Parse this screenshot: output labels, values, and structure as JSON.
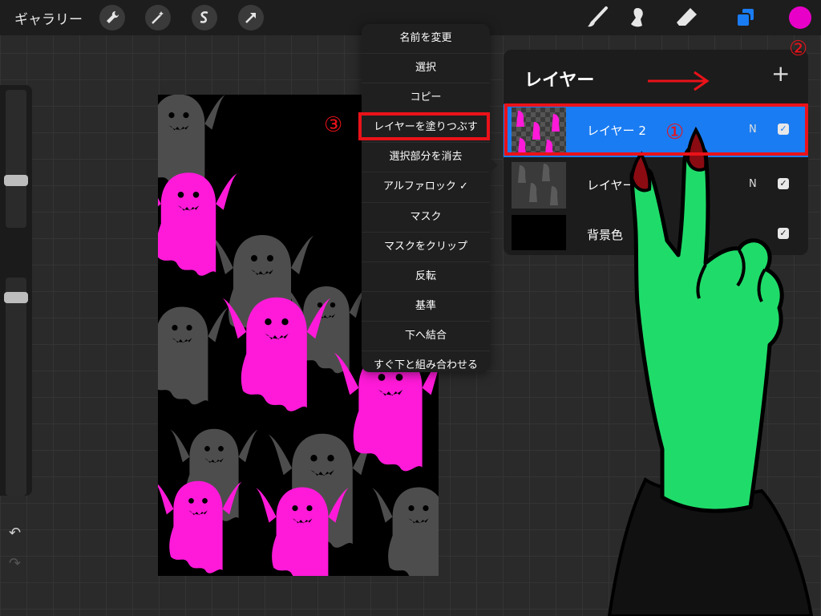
{
  "topbar": {
    "gallery_label": "ギャラリー",
    "left_tools": [
      "wrench-icon",
      "magic-wand-icon",
      "selection-s-icon",
      "arrow-transform-icon"
    ],
    "right_tools": [
      "brush-icon",
      "smudge-icon",
      "eraser-icon",
      "layers-icon"
    ],
    "current_color": "#e800c8"
  },
  "menu": {
    "items": [
      "名前を変更",
      "選択",
      "コピー",
      "レイヤーを塗りつぶす",
      "選択部分を消去",
      "アルファロック ✓",
      "マスク",
      "マスクをクリップ",
      "反転",
      "基準",
      "下へ結合",
      "すぐ下と組み合わせる"
    ]
  },
  "layers": {
    "title": "レイヤー",
    "add_label": "+",
    "rows": [
      {
        "name": "レイヤー 2",
        "mode": "N",
        "visible": "✓",
        "active": true
      },
      {
        "name": "レイヤー",
        "mode": "N",
        "visible": "✓",
        "active": false
      },
      {
        "name": "背景色",
        "mode": "",
        "visible": "✓",
        "active": false
      }
    ]
  },
  "annotations": {
    "one": "①",
    "two": "②",
    "three": "③"
  },
  "colors": {
    "accent_blue": "#1a7cf2",
    "annotation_red": "#ea1219",
    "ghost_pink": "#ff1ad9",
    "ghost_gray": "#4d4d4d",
    "hand_green": "#1fdc6a"
  }
}
